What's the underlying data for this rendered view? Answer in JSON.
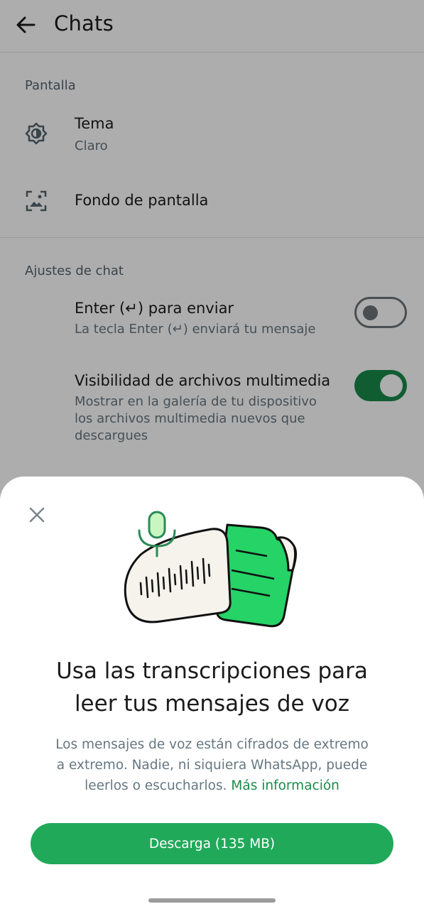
{
  "header": {
    "title": "Chats"
  },
  "display_section": {
    "label": "Pantalla",
    "theme": {
      "title": "Tema",
      "value": "Claro"
    },
    "wallpaper": {
      "title": "Fondo de pantalla"
    }
  },
  "chat_settings": {
    "label": "Ajustes de chat",
    "enter_to_send": {
      "title": "Enter (↵) para enviar",
      "subtitle": "La tecla Enter (↵) enviará tu mensaje",
      "enabled": false
    },
    "media_visibility": {
      "title": "Visibilidad de archivos multimedia",
      "subtitle_lines": [
        "Mostrar en la galería de tu dispositivo",
        "los archivos multimedia nuevos que",
        "descargues"
      ],
      "enabled": true
    }
  },
  "sheet": {
    "title_lines": [
      "Usa las transcripciones para",
      "leer tus mensajes de voz"
    ],
    "body_lines": [
      "Los mensajes de voz están cifrados de extremo",
      "a extremo. Nadie, ni siquiera WhatsApp, puede",
      "leerlos o escucharlos."
    ],
    "link": "Más información",
    "button_label": "Descarga (135 MB)"
  },
  "icons": {
    "back": "arrow-left-icon",
    "theme": "brightness-icon",
    "wallpaper": "wallpaper-icon",
    "close": "close-icon"
  },
  "colors": {
    "accent": "#21a95a",
    "accent_dark": "#1a8a4a",
    "switch_off": "#6b7378"
  }
}
